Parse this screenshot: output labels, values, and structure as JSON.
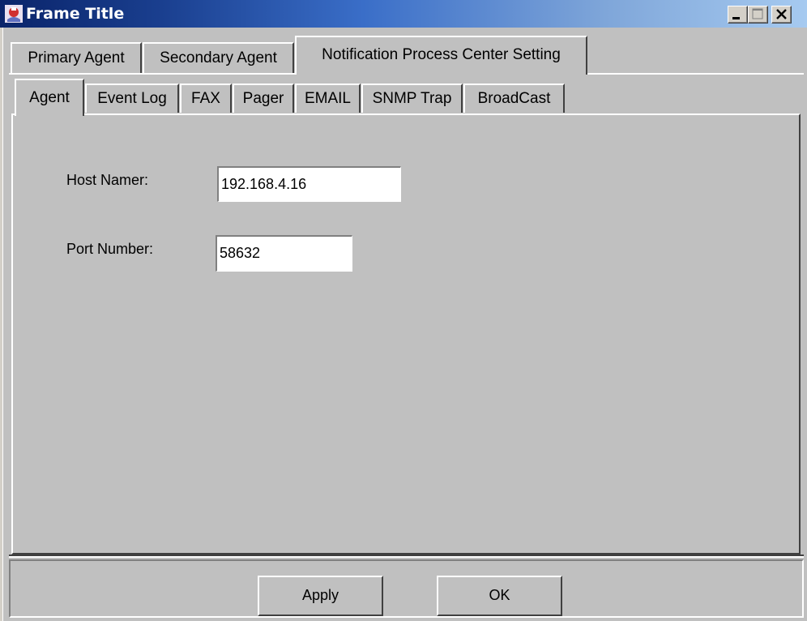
{
  "window": {
    "title": "Frame Title",
    "controls": {
      "minimize_icon": "minimize-icon",
      "maximize_icon": "maximize-icon",
      "close_icon": "close-icon"
    },
    "colors": {
      "titlebar_start": "#0a246a",
      "titlebar_end": "#a6caf0",
      "face": "#c0c0c0"
    }
  },
  "outer_tabs": [
    {
      "label": "Primary Agent",
      "selected": false
    },
    {
      "label": "Secondary Agent",
      "selected": false
    },
    {
      "label": "Notification Process Center Setting",
      "selected": true
    }
  ],
  "inner_tabs": [
    {
      "label": "Agent",
      "selected": true
    },
    {
      "label": "Event Log",
      "selected": false
    },
    {
      "label": "FAX",
      "selected": false
    },
    {
      "label": "Pager",
      "selected": false
    },
    {
      "label": "EMAIL",
      "selected": false
    },
    {
      "label": "SNMP Trap",
      "selected": false
    },
    {
      "label": "BroadCast",
      "selected": false
    }
  ],
  "form": {
    "host_label": "Host Namer:",
    "host_value": "192.168.4.16",
    "port_label": "Port Number:",
    "port_value": "58632"
  },
  "buttons": {
    "apply": "Apply",
    "ok": "OK"
  }
}
